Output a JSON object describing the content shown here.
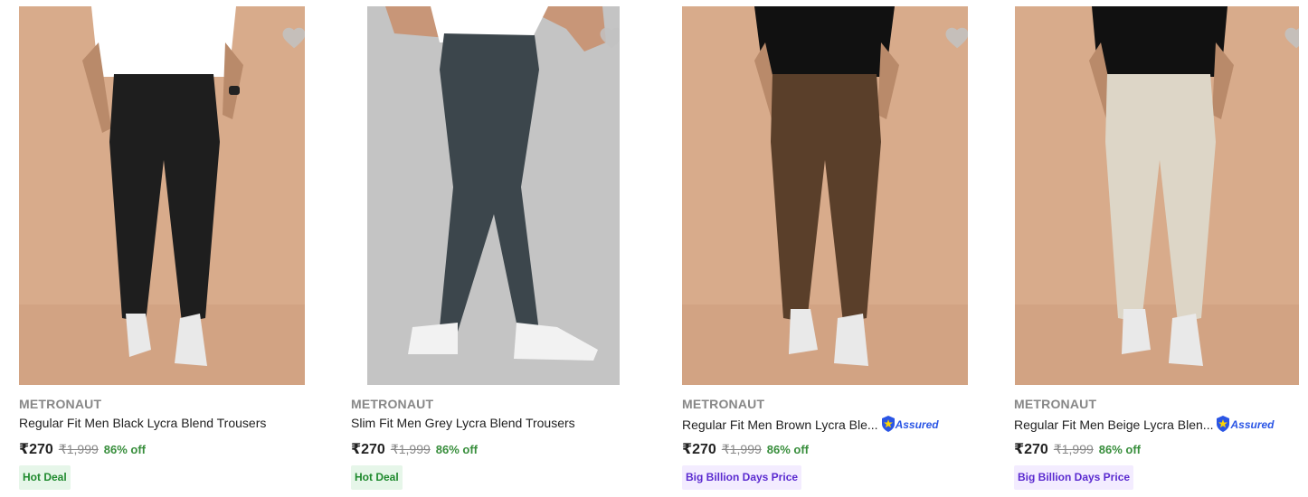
{
  "colors": {
    "discount": "#388e3c",
    "mrp": "#878787",
    "assured": "#2a55e5",
    "hot_deal_bg": "#e6f6e9",
    "bbd_bg": "#f3ecff"
  },
  "products": [
    {
      "brand": "METRONAUT",
      "title": "Regular Fit Men Black Lycra Blend Trousers",
      "price": "₹270",
      "mrp": "₹1,999",
      "discount": "86% off",
      "badge": "Hot Deal",
      "assured": false,
      "trouser_color": "#1e1e1e",
      "image_icon": "product-image-black-trousers"
    },
    {
      "brand": "METRONAUT",
      "title": "Slim Fit Men Grey Lycra Blend Trousers",
      "price": "₹270",
      "mrp": "₹1,999",
      "discount": "86% off",
      "badge": "Hot Deal",
      "assured": false,
      "trouser_color": "#3c464c",
      "image_icon": "product-image-grey-trousers"
    },
    {
      "brand": "METRONAUT",
      "title": "Regular Fit Men Brown Lycra Ble...",
      "price": "₹270",
      "mrp": "₹1,999",
      "discount": "86% off",
      "badge": "Big Billion Days Price",
      "assured": true,
      "assured_label": "Assured",
      "trouser_color": "#5a3f2a",
      "image_icon": "product-image-brown-trousers"
    },
    {
      "brand": "METRONAUT",
      "title": "Regular Fit Men Beige Lycra Blen...",
      "price": "₹270",
      "mrp": "₹1,999",
      "discount": "86% off",
      "badge": "Big Billion Days Price",
      "assured": true,
      "assured_label": "Assured",
      "trouser_color": "#ddd6c7",
      "image_icon": "product-image-beige-trousers"
    }
  ]
}
